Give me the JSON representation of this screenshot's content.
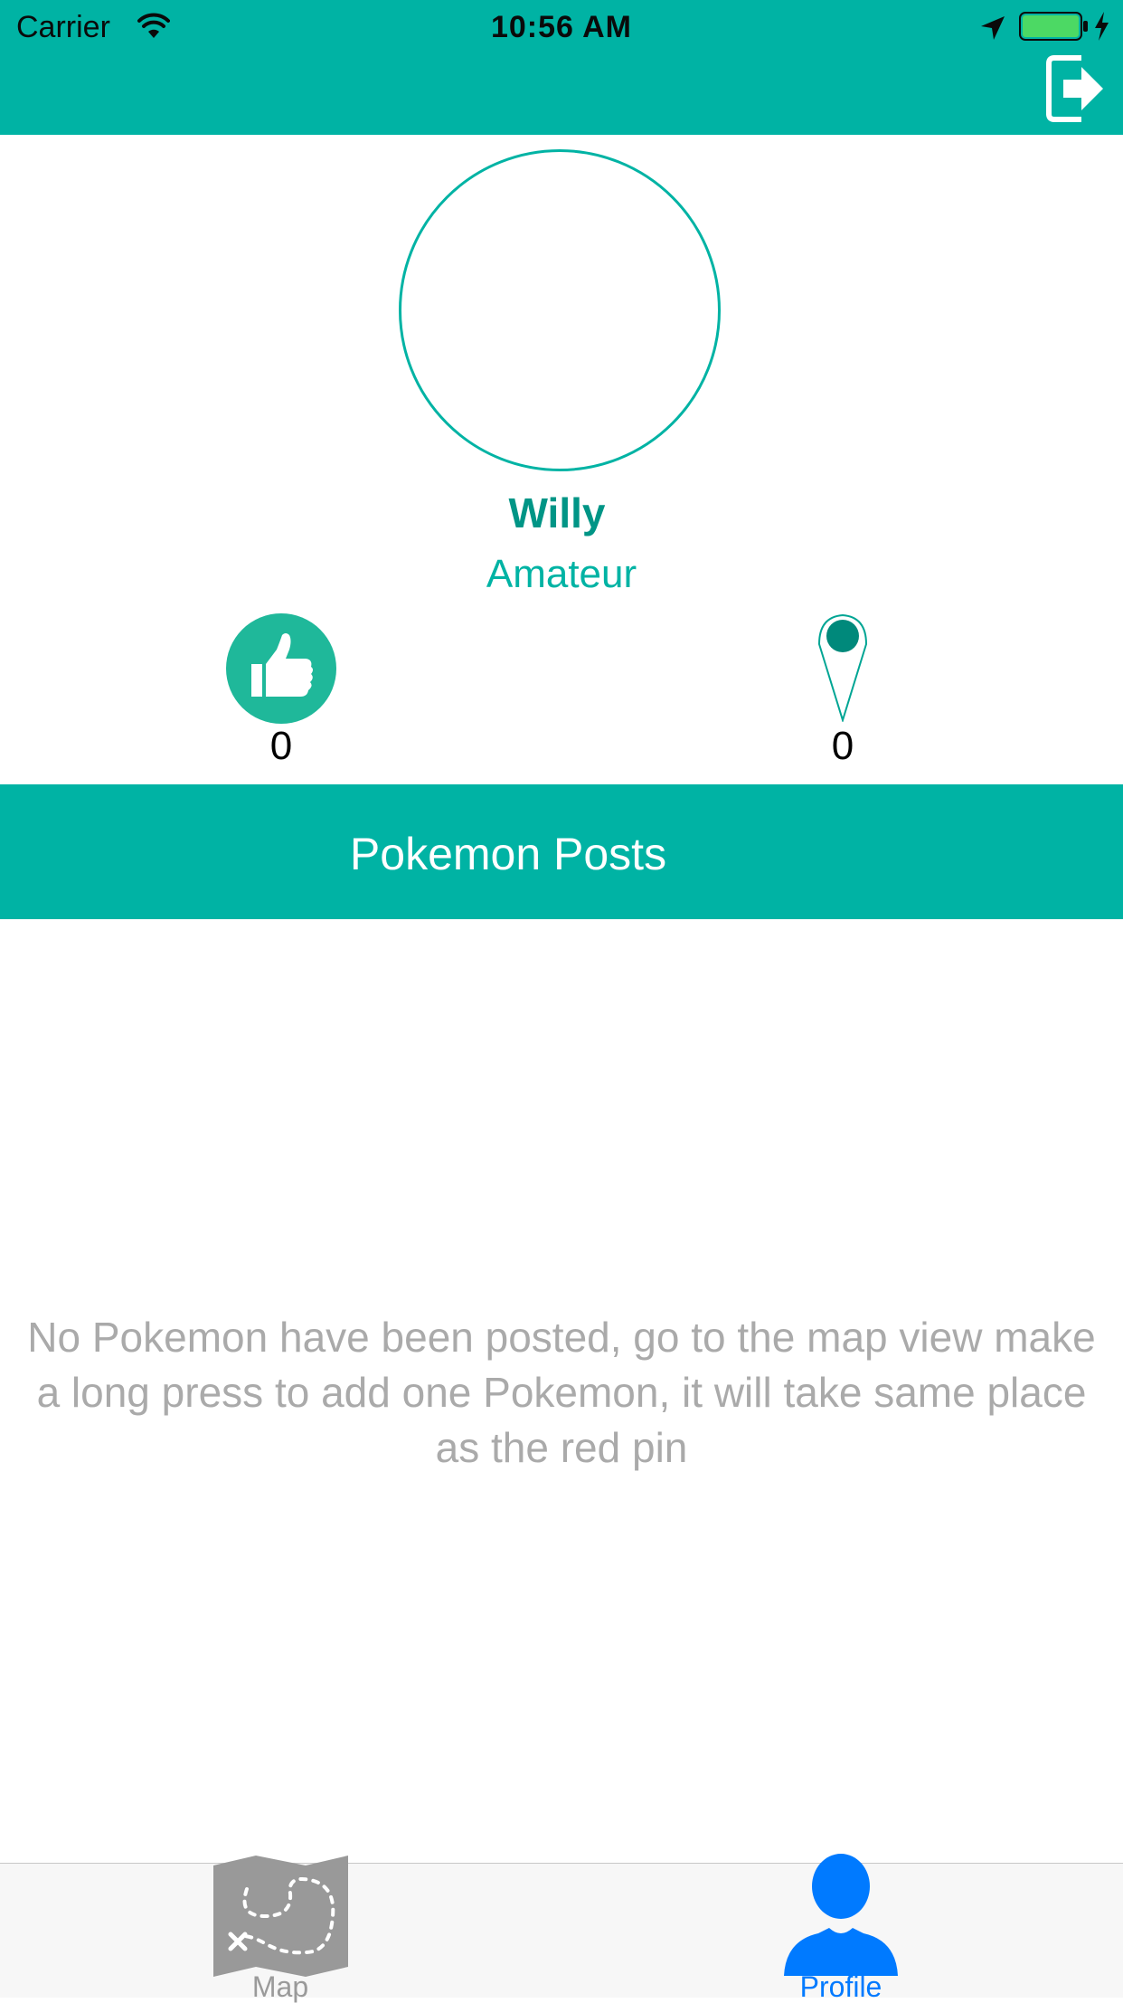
{
  "status_bar": {
    "carrier": "Carrier",
    "time": "10:56 AM",
    "battery_color": "#4cd964"
  },
  "header": {
    "background": "#00b3a4",
    "logout_icon": "logout-arrow-icon"
  },
  "profile": {
    "name": "Willy",
    "rank": "Amateur",
    "stats": {
      "likes_icon": "thumbs-up-icon",
      "likes": "0",
      "pins_icon": "map-pin-icon",
      "pins": "0"
    }
  },
  "posts_section": {
    "title": "Pokemon Posts",
    "empty_message": "No Pokemon have been posted, go to the map view make a long press to add one Pokemon, it will take same place as the red pin"
  },
  "tab_bar": {
    "tabs": [
      {
        "label": "Map",
        "icon": "treasure-map-icon",
        "color": "#9a9a9a",
        "selected": false
      },
      {
        "label": "Profile",
        "icon": "person-icon",
        "color": "#007aff",
        "selected": true
      }
    ]
  },
  "colors": {
    "accent": "#00b3a4",
    "accent_dark": "#009586",
    "tab_selected": "#007aff",
    "muted_text": "#aaaaaa"
  }
}
